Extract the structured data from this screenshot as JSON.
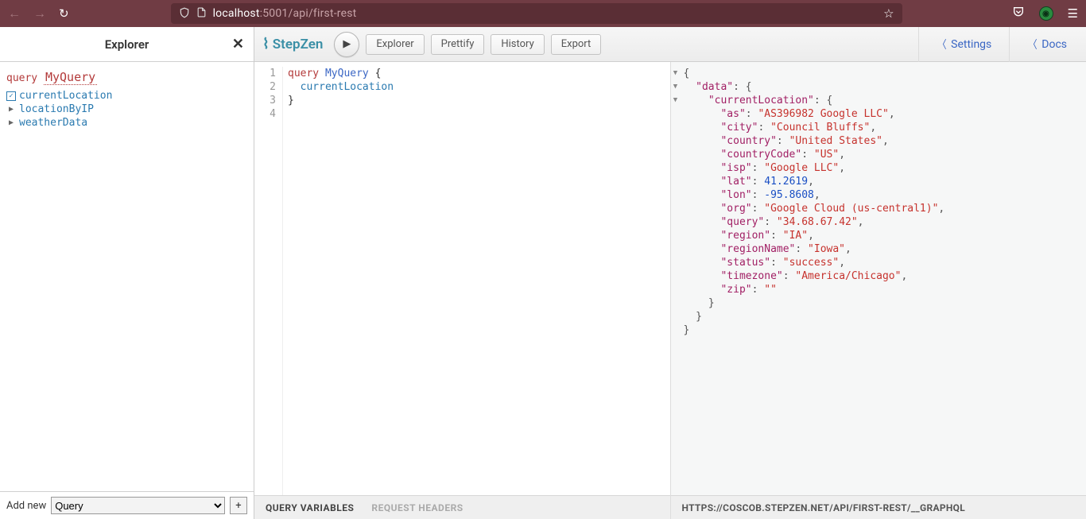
{
  "browser": {
    "url_host": "localhost",
    "url_rest": ":5001/api/first-rest"
  },
  "explorer": {
    "title": "Explorer",
    "query_keyword": "query",
    "query_name": "MyQuery",
    "items": [
      {
        "label": "currentLocation",
        "checked": true,
        "expandable": false
      },
      {
        "label": "locationByIP",
        "checked": false,
        "expandable": true
      },
      {
        "label": "weatherData",
        "checked": false,
        "expandable": true
      }
    ],
    "add_new_label": "Add new",
    "add_new_option": "Query"
  },
  "toolbar": {
    "logo": "StepZen",
    "explorer_btn": "Explorer",
    "prettify_btn": "Prettify",
    "history_btn": "History",
    "export_btn": "Export",
    "settings_link": "Settings",
    "docs_link": "Docs"
  },
  "editor": {
    "lines": [
      "1",
      "2",
      "3",
      "4"
    ],
    "tokens": [
      [
        {
          "t": "kw",
          "v": "query "
        },
        {
          "t": "name",
          "v": "MyQuery"
        },
        {
          "t": "",
          "v": " {"
        }
      ],
      [
        {
          "t": "",
          "v": "  "
        },
        {
          "t": "fn",
          "v": "currentLocation"
        }
      ],
      [
        {
          "t": "",
          "v": "}"
        }
      ],
      [
        {
          "t": "",
          "v": ""
        }
      ]
    ]
  },
  "result": {
    "data": {
      "currentLocation": {
        "as": "AS396982 Google LLC",
        "city": "Council Bluffs",
        "country": "United States",
        "countryCode": "US",
        "isp": "Google LLC",
        "lat": 41.2619,
        "lon": -95.8608,
        "org": "Google Cloud (us-central1)",
        "query": "34.68.67.42",
        "region": "IA",
        "regionName": "Iowa",
        "status": "success",
        "timezone": "America/Chicago",
        "zip": ""
      }
    }
  },
  "footer": {
    "query_variables": "QUERY VARIABLES",
    "request_headers": "REQUEST HEADERS",
    "endpoint": "HTTPS://COSCOB.STEPZEN.NET/API/FIRST-REST/__GRAPHQL"
  }
}
